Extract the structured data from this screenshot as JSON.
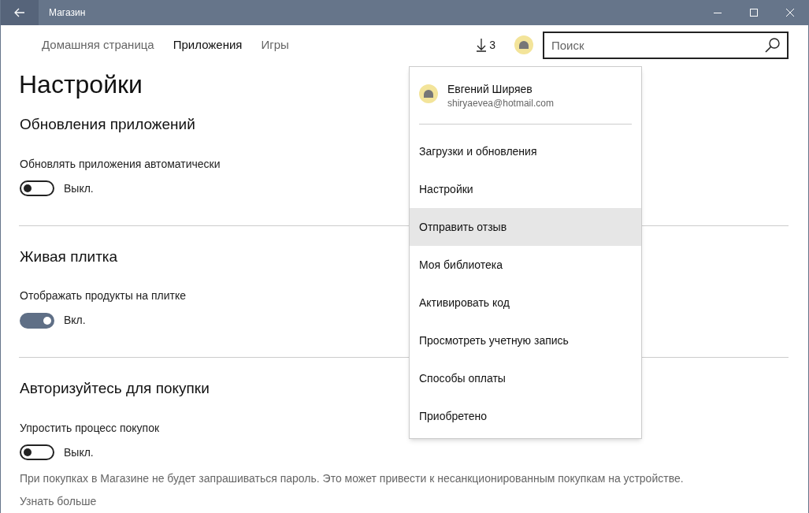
{
  "window": {
    "title": "Магазин"
  },
  "nav": [
    {
      "label": "Домашняя страница",
      "selected": false
    },
    {
      "label": "Приложения",
      "selected": true
    },
    {
      "label": "Игры",
      "selected": false
    }
  ],
  "downloads": {
    "count": "3"
  },
  "search": {
    "placeholder": "Поиск"
  },
  "page_title": "Настройки",
  "sections": [
    {
      "title": "Обновления приложений",
      "setting": "Обновлять приложения автоматически",
      "on": false,
      "state_label": "Выкл."
    },
    {
      "title": "Живая плитка",
      "setting": "Отображать продукты на плитке",
      "on": true,
      "state_label": "Вкл."
    },
    {
      "title": "Авторизуйтесь для покупки",
      "setting": "Упростить процесс покупок",
      "on": false,
      "state_label": "Выкл.",
      "note": "При покупках в Магазине не будет запрашиваться пароль. Это может привести к несанкционированным покупкам на устройстве.",
      "link": "Узнать больше"
    }
  ],
  "account_menu": {
    "name": "Евгений Ширяев",
    "email": "shiryaevea@hotmail.com",
    "items": [
      {
        "label": "Загрузки и обновления",
        "selected": false
      },
      {
        "label": "Настройки",
        "selected": false
      },
      {
        "label": "Отправить отзыв",
        "selected": true
      },
      {
        "label": "Моя библиотека",
        "selected": false
      },
      {
        "label": "Активировать код",
        "selected": false
      },
      {
        "label": "Просмотреть учетную запись",
        "selected": false
      },
      {
        "label": "Способы оплаты",
        "selected": false
      },
      {
        "label": "Приобретено",
        "selected": false
      }
    ]
  }
}
